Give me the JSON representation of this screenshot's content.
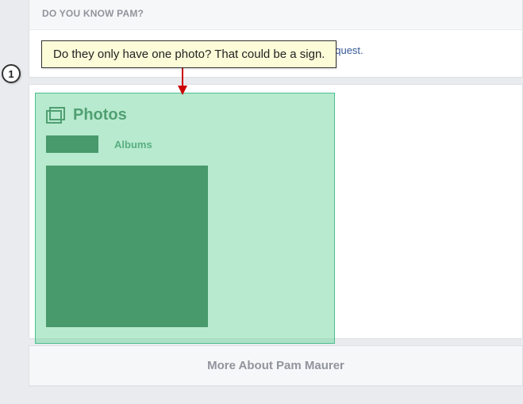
{
  "header": {
    "title": "DO YOU KNOW PAM?"
  },
  "request": {
    "link_fragment": "equest."
  },
  "callout": {
    "text": "Do they only have one photo? That could be a sign.",
    "step_number": "1"
  },
  "photos_section": {
    "title": "Photos",
    "tabs": {
      "albums": "Albums"
    }
  },
  "footer": {
    "more_about": "More About Pam Maurer"
  }
}
